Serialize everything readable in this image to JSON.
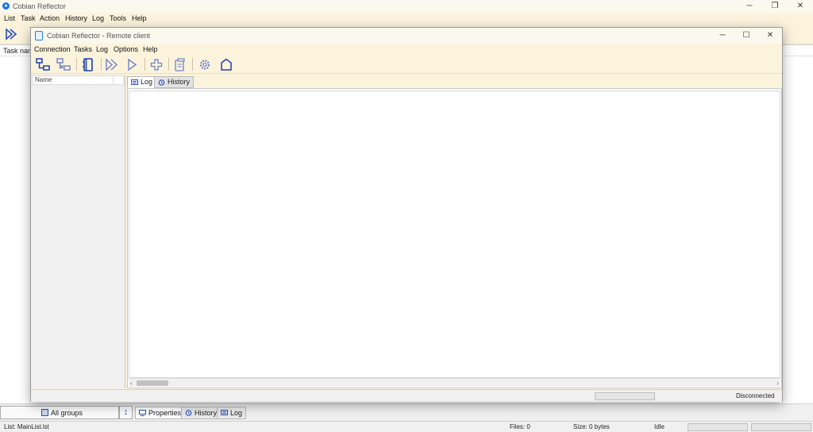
{
  "main_window": {
    "title": "Cobian Reflector",
    "menu": [
      "List",
      "Task",
      "Action",
      "History",
      "Log",
      "Tools",
      "Help"
    ],
    "list_header": "Task name",
    "groups_label": "All groups",
    "bottom_tabs": [
      "Properties",
      "History",
      "Log"
    ],
    "status": {
      "list": "List: MainList.lst",
      "files": "Files: 0",
      "size": "Size: 0 bytes",
      "state": "Idle"
    }
  },
  "remote_window": {
    "title": "Cobian Reflector - Remote client",
    "menu": [
      "Connection",
      "Tasks",
      "Log",
      "Options",
      "Help"
    ],
    "toolbar_icons": [
      "connect-icon",
      "disconnect-icon",
      "log-book-icon",
      "run-all-icon",
      "run-selected-icon",
      "add-task-icon",
      "clipboard-icon",
      "settings-gear-icon",
      "home-icon"
    ],
    "left_header": "Name",
    "tabs": [
      "Log",
      "History"
    ],
    "status_text": "Disconnected"
  },
  "colors": {
    "accent": "#2a4fbf",
    "window_bg": "#fbf3dc",
    "title_bg": "#fbf8ee"
  }
}
